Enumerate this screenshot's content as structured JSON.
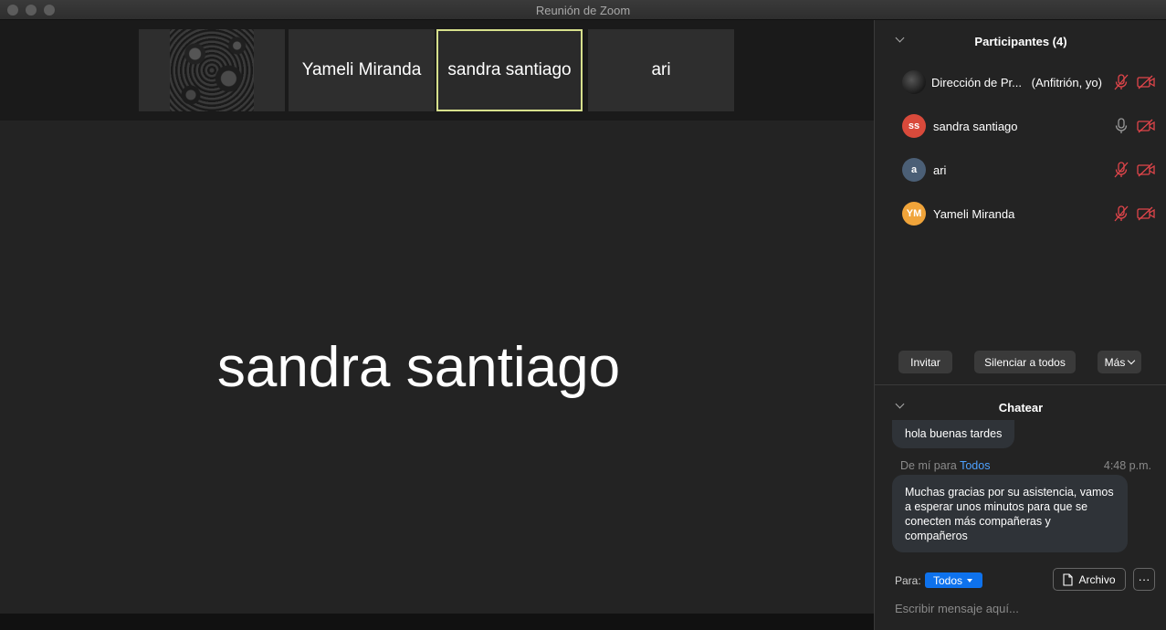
{
  "window": {
    "title": "Reunión de Zoom"
  },
  "thumbnails": [
    {
      "name": "",
      "has_image": true
    },
    {
      "name": "Yameli Miranda"
    },
    {
      "name": "sandra santiago",
      "active": true
    },
    {
      "name": "ari"
    }
  ],
  "speaker": {
    "name": "sandra santiago"
  },
  "participants_panel": {
    "title": "Participantes (4)",
    "items": [
      {
        "name": "Dirección de Pr...",
        "tag": "(Anfitrión, yo)",
        "avatar": "",
        "avatar_color": "#222222",
        "mic": "muted",
        "video": "off"
      },
      {
        "name": "sandra santiago",
        "tag": "",
        "avatar": "ss",
        "avatar_color": "#d94a3b",
        "mic": "on",
        "video": "off"
      },
      {
        "name": "ari",
        "tag": "",
        "avatar": "a",
        "avatar_color": "#4b5f76",
        "mic": "muted",
        "video": "off"
      },
      {
        "name": "Yameli Miranda",
        "tag": "",
        "avatar": "YM",
        "avatar_color": "#f0a43a",
        "mic": "muted",
        "video": "off"
      }
    ],
    "buttons": {
      "invite": "Invitar",
      "mute_all": "Silenciar a todos",
      "more": "Más"
    }
  },
  "chat_panel": {
    "title": "Chatear",
    "messages": [
      {
        "text": "hola buenas tardes"
      },
      {
        "from": "De mí para",
        "to": "Todos",
        "time": "4:48 p.m.",
        "text": "Muchas gracias por su asistencia, vamos a esperar unos minutos para que se conecten más compañeras y compañeros"
      }
    ],
    "to_label": "Para:",
    "to_value": "Todos",
    "file_label": "Archivo",
    "more_label": "···",
    "input_placeholder": "Escribir mensaje aquí..."
  },
  "colors": {
    "accent": "#0e72ed",
    "active_border": "#d7e08c",
    "muted_red": "#e0454a"
  }
}
